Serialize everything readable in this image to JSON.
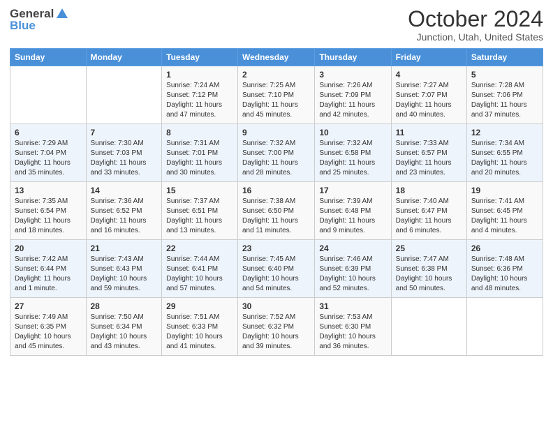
{
  "header": {
    "logo_general": "General",
    "logo_blue": "Blue",
    "title": "October 2024",
    "subtitle": "Junction, Utah, United States"
  },
  "weekdays": [
    "Sunday",
    "Monday",
    "Tuesday",
    "Wednesday",
    "Thursday",
    "Friday",
    "Saturday"
  ],
  "weeks": [
    [
      {
        "day": "",
        "detail": ""
      },
      {
        "day": "",
        "detail": ""
      },
      {
        "day": "1",
        "detail": "Sunrise: 7:24 AM\nSunset: 7:12 PM\nDaylight: 11 hours and 47 minutes."
      },
      {
        "day": "2",
        "detail": "Sunrise: 7:25 AM\nSunset: 7:10 PM\nDaylight: 11 hours and 45 minutes."
      },
      {
        "day": "3",
        "detail": "Sunrise: 7:26 AM\nSunset: 7:09 PM\nDaylight: 11 hours and 42 minutes."
      },
      {
        "day": "4",
        "detail": "Sunrise: 7:27 AM\nSunset: 7:07 PM\nDaylight: 11 hours and 40 minutes."
      },
      {
        "day": "5",
        "detail": "Sunrise: 7:28 AM\nSunset: 7:06 PM\nDaylight: 11 hours and 37 minutes."
      }
    ],
    [
      {
        "day": "6",
        "detail": "Sunrise: 7:29 AM\nSunset: 7:04 PM\nDaylight: 11 hours and 35 minutes."
      },
      {
        "day": "7",
        "detail": "Sunrise: 7:30 AM\nSunset: 7:03 PM\nDaylight: 11 hours and 33 minutes."
      },
      {
        "day": "8",
        "detail": "Sunrise: 7:31 AM\nSunset: 7:01 PM\nDaylight: 11 hours and 30 minutes."
      },
      {
        "day": "9",
        "detail": "Sunrise: 7:32 AM\nSunset: 7:00 PM\nDaylight: 11 hours and 28 minutes."
      },
      {
        "day": "10",
        "detail": "Sunrise: 7:32 AM\nSunset: 6:58 PM\nDaylight: 11 hours and 25 minutes."
      },
      {
        "day": "11",
        "detail": "Sunrise: 7:33 AM\nSunset: 6:57 PM\nDaylight: 11 hours and 23 minutes."
      },
      {
        "day": "12",
        "detail": "Sunrise: 7:34 AM\nSunset: 6:55 PM\nDaylight: 11 hours and 20 minutes."
      }
    ],
    [
      {
        "day": "13",
        "detail": "Sunrise: 7:35 AM\nSunset: 6:54 PM\nDaylight: 11 hours and 18 minutes."
      },
      {
        "day": "14",
        "detail": "Sunrise: 7:36 AM\nSunset: 6:52 PM\nDaylight: 11 hours and 16 minutes."
      },
      {
        "day": "15",
        "detail": "Sunrise: 7:37 AM\nSunset: 6:51 PM\nDaylight: 11 hours and 13 minutes."
      },
      {
        "day": "16",
        "detail": "Sunrise: 7:38 AM\nSunset: 6:50 PM\nDaylight: 11 hours and 11 minutes."
      },
      {
        "day": "17",
        "detail": "Sunrise: 7:39 AM\nSunset: 6:48 PM\nDaylight: 11 hours and 9 minutes."
      },
      {
        "day": "18",
        "detail": "Sunrise: 7:40 AM\nSunset: 6:47 PM\nDaylight: 11 hours and 6 minutes."
      },
      {
        "day": "19",
        "detail": "Sunrise: 7:41 AM\nSunset: 6:45 PM\nDaylight: 11 hours and 4 minutes."
      }
    ],
    [
      {
        "day": "20",
        "detail": "Sunrise: 7:42 AM\nSunset: 6:44 PM\nDaylight: 11 hours and 1 minute."
      },
      {
        "day": "21",
        "detail": "Sunrise: 7:43 AM\nSunset: 6:43 PM\nDaylight: 10 hours and 59 minutes."
      },
      {
        "day": "22",
        "detail": "Sunrise: 7:44 AM\nSunset: 6:41 PM\nDaylight: 10 hours and 57 minutes."
      },
      {
        "day": "23",
        "detail": "Sunrise: 7:45 AM\nSunset: 6:40 PM\nDaylight: 10 hours and 54 minutes."
      },
      {
        "day": "24",
        "detail": "Sunrise: 7:46 AM\nSunset: 6:39 PM\nDaylight: 10 hours and 52 minutes."
      },
      {
        "day": "25",
        "detail": "Sunrise: 7:47 AM\nSunset: 6:38 PM\nDaylight: 10 hours and 50 minutes."
      },
      {
        "day": "26",
        "detail": "Sunrise: 7:48 AM\nSunset: 6:36 PM\nDaylight: 10 hours and 48 minutes."
      }
    ],
    [
      {
        "day": "27",
        "detail": "Sunrise: 7:49 AM\nSunset: 6:35 PM\nDaylight: 10 hours and 45 minutes."
      },
      {
        "day": "28",
        "detail": "Sunrise: 7:50 AM\nSunset: 6:34 PM\nDaylight: 10 hours and 43 minutes."
      },
      {
        "day": "29",
        "detail": "Sunrise: 7:51 AM\nSunset: 6:33 PM\nDaylight: 10 hours and 41 minutes."
      },
      {
        "day": "30",
        "detail": "Sunrise: 7:52 AM\nSunset: 6:32 PM\nDaylight: 10 hours and 39 minutes."
      },
      {
        "day": "31",
        "detail": "Sunrise: 7:53 AM\nSunset: 6:30 PM\nDaylight: 10 hours and 36 minutes."
      },
      {
        "day": "",
        "detail": ""
      },
      {
        "day": "",
        "detail": ""
      }
    ]
  ]
}
